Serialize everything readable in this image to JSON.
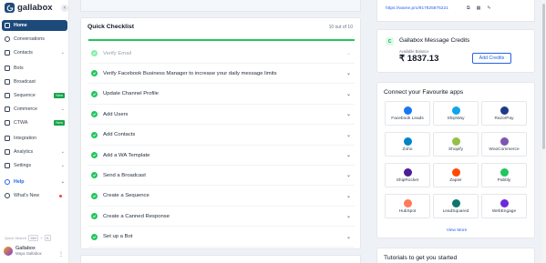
{
  "app": {
    "name": "gallabox"
  },
  "sidebar": {
    "items": [
      {
        "label": "Home",
        "icon": "home-icon"
      },
      {
        "label": "Conversations",
        "icon": "chat-icon"
      },
      {
        "label": "Contacts",
        "icon": "contacts-icon",
        "chevron": true
      },
      {
        "label": "Bots",
        "icon": "bot-icon"
      },
      {
        "label": "Broadcast",
        "icon": "broadcast-icon"
      },
      {
        "label": "Sequence",
        "icon": "sequence-icon",
        "badge": "New"
      },
      {
        "label": "Commerce",
        "icon": "commerce-icon",
        "chevron": true
      },
      {
        "label": "CTWA",
        "icon": "ctwa-icon",
        "badge": "New"
      },
      {
        "label": "Integration",
        "icon": "integration-icon"
      },
      {
        "label": "Analytics",
        "icon": "analytics-icon",
        "chevron": true
      },
      {
        "label": "Settings",
        "icon": "settings-icon",
        "chevron": true
      },
      {
        "label": "Help",
        "icon": "help-icon",
        "chevron": true
      },
      {
        "label": "What's New",
        "icon": "gift-icon",
        "dot": true
      }
    ],
    "quick_search": {
      "label": "Quick Search",
      "key1": "Ctrl",
      "plus": "+",
      "key2": "K"
    },
    "user": {
      "name": "Gallabox",
      "sub": "Maya Gallabox"
    }
  },
  "checklist": {
    "title": "Quick Checklist",
    "count": "10 out of 10",
    "progress": 1.0,
    "items": [
      {
        "label": "Verify Email",
        "muted": true
      },
      {
        "label": "Verify Facebook Business Manager to increase your daily message limits"
      },
      {
        "label": "Update Channel Profile"
      },
      {
        "label": "Add Users"
      },
      {
        "label": "Add Contacts"
      },
      {
        "label": "Add a WA Template"
      },
      {
        "label": "Send a Broadcast"
      },
      {
        "label": "Create a Sequence"
      },
      {
        "label": "Create a Canned Response"
      },
      {
        "label": "Set up a Bot"
      }
    ]
  },
  "wa": {
    "link": "https://wame.pro/917825875221"
  },
  "credits": {
    "title": "Gallabox Message Credits",
    "balance_label": "Available Balance",
    "balance": "₹ 1837.13",
    "add_button": "Add Credits"
  },
  "apps": {
    "title": "Connect your Favourite apps",
    "view_more": "View More",
    "items": [
      {
        "name": "Facebook Leads",
        "color": "#1877f2"
      },
      {
        "name": "ShipWay",
        "color": "#0ea5e9"
      },
      {
        "name": "RazorPay",
        "color": "#1e3a8a"
      },
      {
        "name": "Zoho",
        "color": "#0284c7"
      },
      {
        "name": "Shopify",
        "color": "#95bf47"
      },
      {
        "name": "WooCommerce",
        "color": "#7f54b3"
      },
      {
        "name": "ShipRocket",
        "color": "#4c1d95"
      },
      {
        "name": "Zapier",
        "color": "#ff4a00"
      },
      {
        "name": "Pabbly",
        "color": "#22c55e"
      },
      {
        "name": "HubSpot",
        "color": "#ff7a59"
      },
      {
        "name": "LeadSquared",
        "color": "#0f766e"
      },
      {
        "name": "WebEngage",
        "color": "#6d28d9"
      }
    ]
  },
  "tutorials": {
    "title": "Tutorials to get you started"
  }
}
